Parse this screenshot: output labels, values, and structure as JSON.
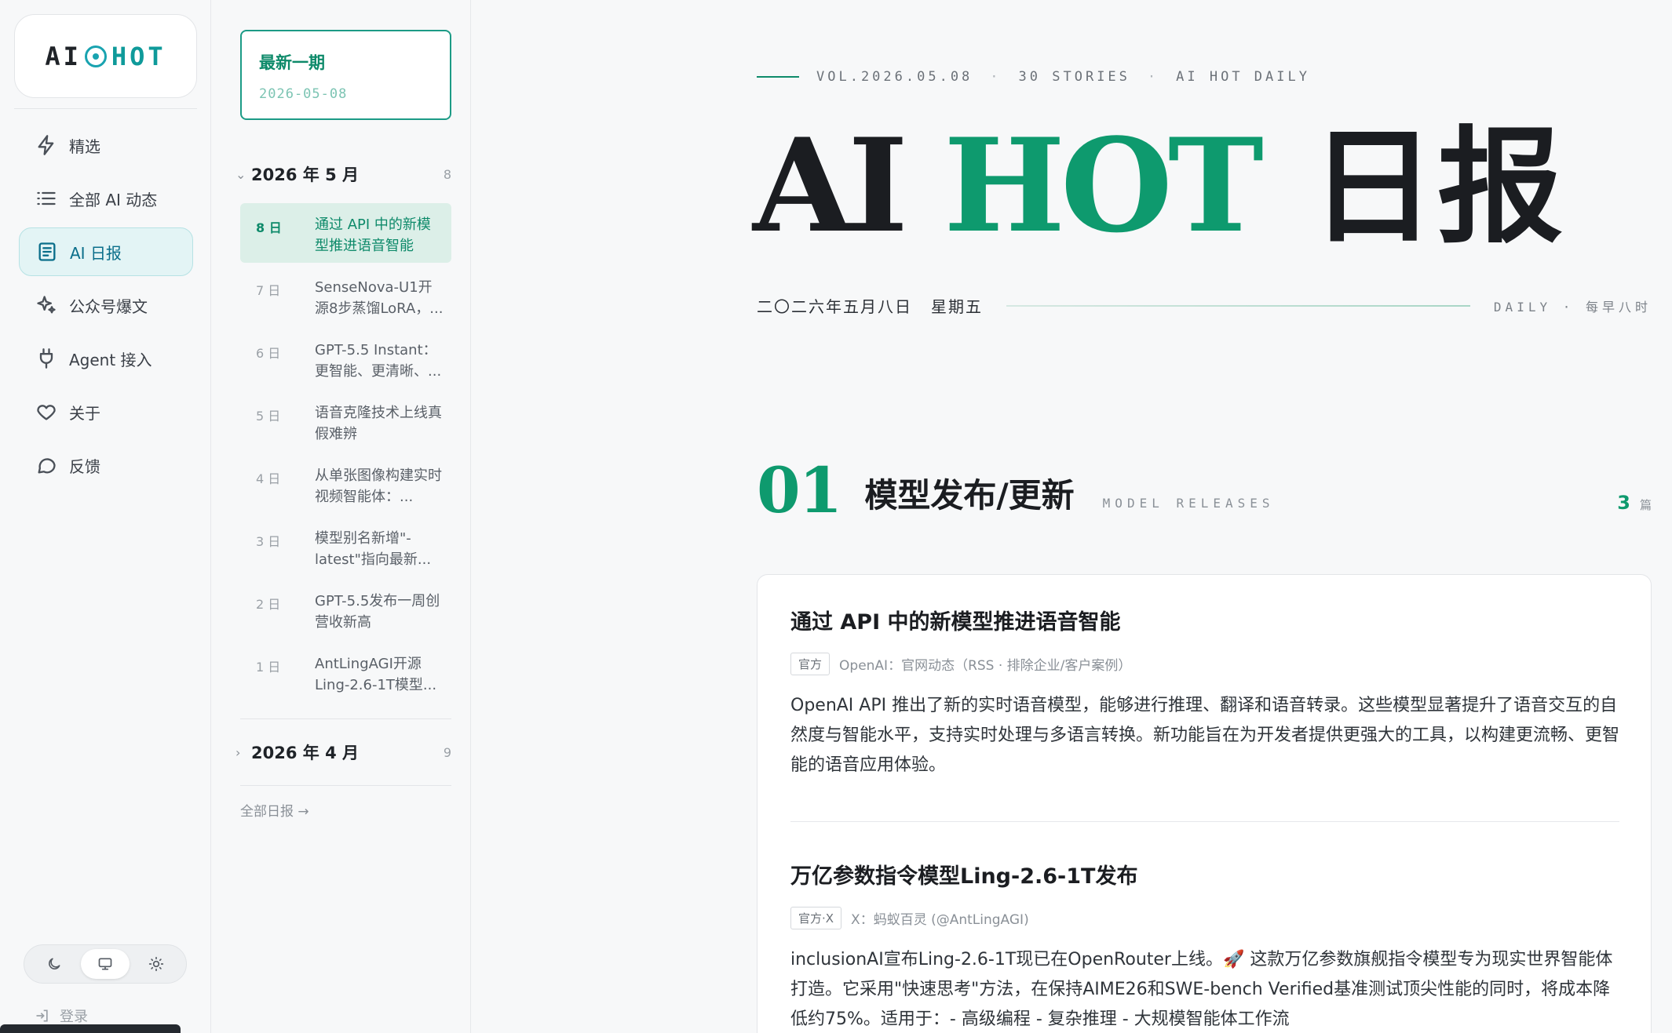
{
  "sidebar": {
    "logo_left": "AI",
    "logo_right": "HOT",
    "items": [
      {
        "label": "精选",
        "icon": "bolt-icon"
      },
      {
        "label": "全部 AI 动态",
        "icon": "list-icon"
      },
      {
        "label": "AI 日报",
        "icon": "newspaper-icon"
      },
      {
        "label": "公众号爆文",
        "icon": "sparkles-icon"
      },
      {
        "label": "Agent 接入",
        "icon": "plug-icon"
      },
      {
        "label": "关于",
        "icon": "heart-icon"
      },
      {
        "label": "反馈",
        "icon": "chat-icon"
      }
    ],
    "active_item": "AI 日报",
    "theme_options": [
      "moon-icon",
      "monitor-icon",
      "sun-icon"
    ],
    "theme_selected": "monitor-icon",
    "login_label": "登录"
  },
  "issues": {
    "latest_title": "最新一期",
    "latest_date": "2026-05-08",
    "months": [
      {
        "label": "2026 年 5 月",
        "count": "8",
        "expanded": true,
        "items": [
          {
            "day": "8 日",
            "title": "通过 API 中的新模型推进语音智能"
          },
          {
            "day": "7 日",
            "title": "SenseNova-U1开源8步蒸馏LoRA，..."
          },
          {
            "day": "6 日",
            "title": "GPT-5.5 Instant：更智能、更清晰、..."
          },
          {
            "day": "5 日",
            "title": "语音克隆技术上线真假难辨"
          },
          {
            "day": "4 日",
            "title": "从单张图像构建实时视频智能体：..."
          },
          {
            "day": "3 日",
            "title": "模型别名新增\"-latest\"指向最新..."
          },
          {
            "day": "2 日",
            "title": "GPT-5.5发布一周创营收新高"
          },
          {
            "day": "1 日",
            "title": "AntLingAGI开源Ling-2.6-1T模型..."
          }
        ]
      },
      {
        "label": "2026 年 4 月",
        "count": "9",
        "expanded": false
      }
    ],
    "all_link": "全部日报 →"
  },
  "main": {
    "meta": {
      "vol": "VOL.2026.05.08",
      "stories": "30 STORIES",
      "brand": "AI HOT DAILY"
    },
    "title_ai": "AI",
    "title_hot": "HOT",
    "title_cn": "日报",
    "date_cn": "二〇二六年五月八日",
    "weekday": "星期五",
    "daily_tag": "DAILY · 每早八时",
    "section": {
      "num": "01",
      "title": "模型发布/更新",
      "en": "MODEL RELEASES",
      "count": "3",
      "count_unit": "篇"
    },
    "stories": [
      {
        "title": "通过 API 中的新模型推进语音智能",
        "badge": "官方",
        "source": "OpenAI：官网动态（RSS · 排除企业/客户案例）",
        "body": "OpenAI API 推出了新的实时语音模型，能够进行推理、翻译和语音转录。这些模型显著提升了语音交互的自然度与智能水平，支持实时处理与多语言转换。新功能旨在为开发者提供更强大的工具，以构建更流畅、更智能的语音应用体验。"
      },
      {
        "title": "万亿参数指令模型Ling-2.6-1T发布",
        "badge": "官方·X",
        "source": "X：蚂蚁百灵 (@AntLingAGI)",
        "body": "inclusionAI宣布Ling-2.6-1T现已在OpenRouter上线。🚀 这款万亿参数旗舰指令模型专为现实世界智能体打造。它采用\"快速思考\"方法，在保持AIME26和SWE-bench Verified基准测试顶尖性能的同时，将成本降低约75%。适用于：- 高级编程 - 复杂推理 - 大规模智能体工作流"
      }
    ]
  },
  "colors": {
    "accent": "#0e9a6e",
    "logo_teal": "#0f9a9a",
    "active_nav_bg": "#e3f4f5"
  }
}
